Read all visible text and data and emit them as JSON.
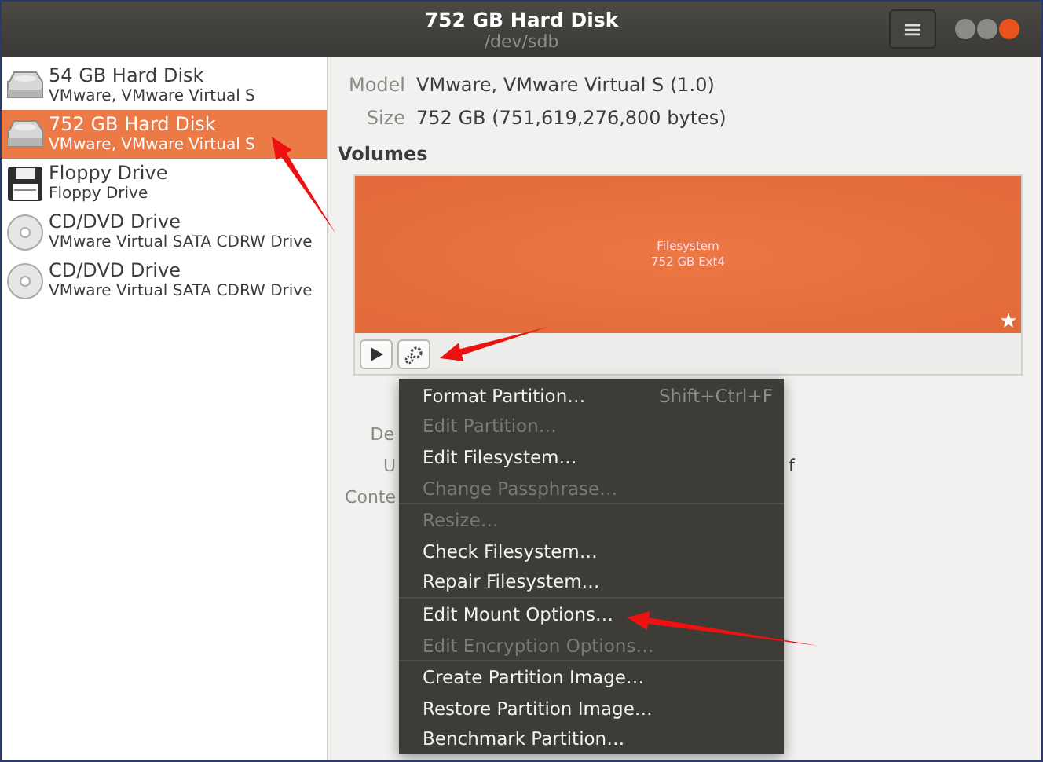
{
  "window": {
    "title": "752 GB Hard Disk",
    "subtitle": "/dev/sdb",
    "menu_button": "≡"
  },
  "devices": [
    {
      "name": "54 GB Hard Disk",
      "description": "VMware, VMware Virtual S",
      "kind": "hdd",
      "selected": false
    },
    {
      "name": "752 GB Hard Disk",
      "description": "VMware, VMware Virtual S",
      "kind": "hdd",
      "selected": true
    },
    {
      "name": "Floppy Drive",
      "description": "Floppy Drive",
      "kind": "floppy",
      "selected": false
    },
    {
      "name": "CD/DVD Drive",
      "description": "VMware Virtual SATA CDRW Drive",
      "kind": "optical",
      "selected": false
    },
    {
      "name": "CD/DVD Drive",
      "description": "VMware Virtual SATA CDRW Drive",
      "kind": "optical",
      "selected": false
    }
  ],
  "disk_info": [
    {
      "label": "Model",
      "value": "VMware, VMware Virtual S (1.0)"
    },
    {
      "label": "Size",
      "value": "752 GB (751,619,276,800 bytes)"
    }
  ],
  "volumes": {
    "heading": "Volumes",
    "partition": {
      "name": "Filesystem",
      "size": "752 GB Ext4"
    }
  },
  "partition_details": [
    {
      "label": "De"
    },
    {
      "label": "U",
      "value": "f"
    },
    {
      "label": "Conte"
    }
  ],
  "menu": [
    [
      {
        "label": "Format Partition…",
        "shortcut": "Shift+Ctrl+F",
        "disabled": false
      },
      {
        "label": "Edit Partition…",
        "disabled": true
      },
      {
        "label": "Edit Filesystem…",
        "disabled": false
      },
      {
        "label": "Change Passphrase…",
        "disabled": true
      }
    ],
    [
      {
        "label": "Resize…",
        "disabled": true
      },
      {
        "label": "Check Filesystem…",
        "disabled": false
      },
      {
        "label": "Repair Filesystem…",
        "disabled": false
      }
    ],
    [
      {
        "label": "Edit Mount Options…",
        "disabled": false
      },
      {
        "label": "Edit Encryption Options…",
        "disabled": true
      }
    ],
    [
      {
        "label": "Create Partition Image…",
        "disabled": false
      },
      {
        "label": "Restore Partition Image…",
        "disabled": false
      },
      {
        "label": "Benchmark Partition…",
        "disabled": false
      }
    ]
  ]
}
